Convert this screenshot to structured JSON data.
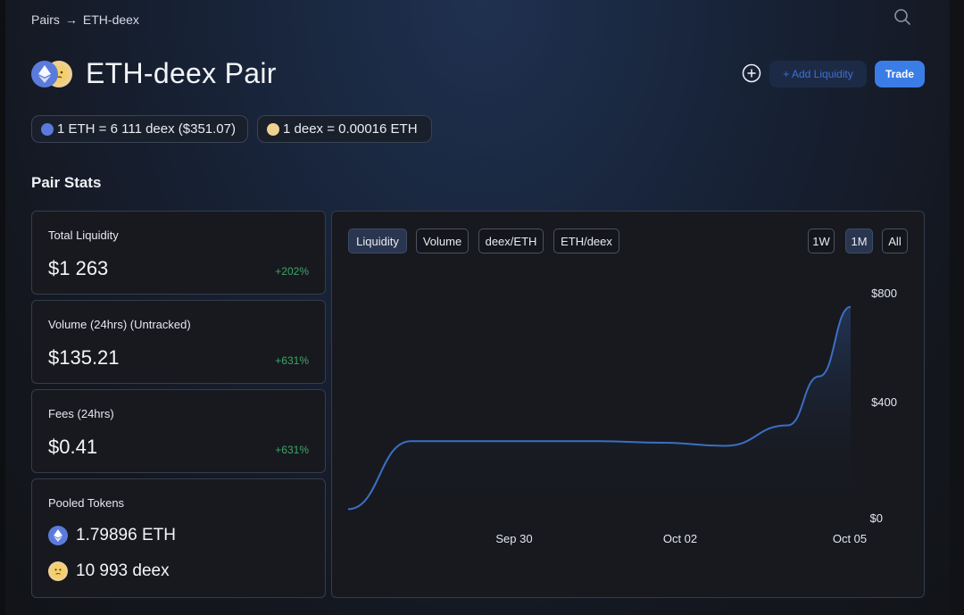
{
  "breadcrumb": {
    "parent": "Pairs",
    "separator": "→",
    "current": "ETH-deex"
  },
  "header": {
    "title": "ETH-deex Pair",
    "add_liquidity_label": "+ Add Liquidity",
    "trade_label": "Trade"
  },
  "rates": {
    "eth_rate": "1 ETH = 6 111 deex ($351.07)",
    "deex_rate": "1 deex = 0.00016 ETH"
  },
  "section_title": "Pair Stats",
  "stats": {
    "total_liquidity": {
      "label": "Total Liquidity",
      "value": "$1 263",
      "change": "+202%"
    },
    "volume": {
      "label": "Volume (24hrs) (Untracked)",
      "value": "$135.21",
      "change": "+631%"
    },
    "fees": {
      "label": "Fees (24hrs)",
      "value": "$0.41",
      "change": "+631%"
    },
    "pooled": {
      "label": "Pooled Tokens",
      "tokens": [
        {
          "amount": "1.79896 ETH",
          "icon": "eth-icon"
        },
        {
          "amount": "10 993 deex",
          "icon": "deex-icon"
        }
      ]
    }
  },
  "chart_tabs": [
    "Liquidity",
    "Volume",
    "deex/ETH",
    "ETH/deex"
  ],
  "chart_ranges": [
    "1W",
    "1M",
    "All"
  ],
  "active_tab": "Liquidity",
  "active_range": "1M",
  "colors": {
    "accent": "#3b7de6",
    "positive": "#3fa564",
    "line": "#3b6fc4",
    "eth": "#5b7bdc",
    "deex": "#f0d090"
  },
  "chart_data": {
    "type": "area",
    "series": [
      {
        "x": [
          "2023-09-27",
          "2023-09-28",
          "2023-09-29",
          "2023-09-30",
          "2023-10-01",
          "2023-10-02",
          "2023-10-03",
          "2023-10-04",
          "2023-10-04T12:00",
          "2023-10-05"
        ],
        "values": [
          30,
          245,
          245,
          245,
          245,
          240,
          230,
          295,
          450,
          670
        ]
      }
    ],
    "x_ticks": [
      "Sep 30",
      "Oct 02",
      "Oct 05"
    ],
    "y_ticks": [
      "$0",
      "$400",
      "$800"
    ],
    "ylim": [
      0,
      830
    ],
    "grid": false,
    "legend": "none"
  }
}
